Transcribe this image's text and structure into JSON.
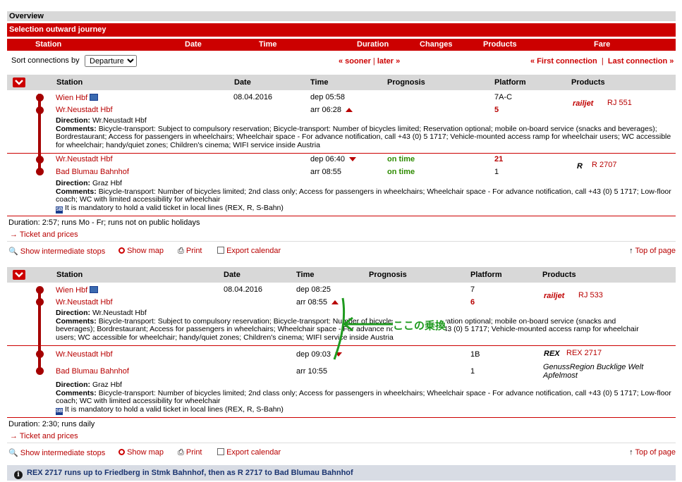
{
  "overview": "Overview",
  "selection": "Selection outward journey",
  "columns": {
    "station": "Station",
    "date": "Date",
    "time": "Time",
    "duration": "Duration",
    "changes": "Changes",
    "products": "Products",
    "fare": "Fare"
  },
  "sort": {
    "label": "Sort connections by",
    "value": "Departure",
    "sooner": "« sooner",
    "sep": "|",
    "later": "later »",
    "first": "« First connection",
    "last": "Last connection »"
  },
  "table_headers": {
    "station": "Station",
    "date": "Date",
    "time": "Time",
    "prognosis": "Prognosis",
    "platform": "Platform",
    "products": "Products"
  },
  "conn1": {
    "leg1": {
      "from": "Wien Hbf",
      "to": "Wr.Neustadt Hbf",
      "date": "08.04.2016",
      "dep": "dep 05:58",
      "arr": "arr 06:28",
      "plat_dep": "7A-C",
      "plat_arr": "5",
      "product_logo": "railjet",
      "product": "RJ 551",
      "direction_label": "Direction:",
      "direction": "Wr.Neustadt Hbf",
      "comments_label": "Comments:",
      "comments": "Bicycle-transport: Subject to compulsory reservation; Bicycle-transport: Number of bicycles limited; Reservation optional; mobile on-board service (snacks and beverages); Bordrestaurant; Access for passengers in wheelchairs; Wheelchair space - For advance notification, call +43 (0) 5 1717; Vehicle-mounted access ramp for wheelchair users; WC accessible for wheelchair; handy/quiet zones; Children's cinema; WIFI service inside Austria"
    },
    "leg2": {
      "from": "Wr.Neustadt Hbf",
      "to": "Bad Blumau Bahnhof",
      "dep": "dep 06:40",
      "arr": "arr 08:55",
      "prog_dep": "on time",
      "prog_arr": "on time",
      "plat_dep": "21",
      "plat_arr": "1",
      "product_logo": "R",
      "product": "R 2707",
      "direction_label": "Direction:",
      "direction": "Graz Hbf",
      "comments_label": "Comments:",
      "comments": "Bicycle-transport: Number of bicycles limited; 2nd class only; Access for passengers in wheelchairs; Wheelchair space - For advance notification, call +43 (0) 5 1717; Low-floor coach; WC with limited accessibility for wheelchair",
      "mandatory": "It is mandatory to hold a valid ticket in local lines (REX, R, S-Bahn)"
    },
    "duration": "Duration: 2:57; runs Mo - Fr; runs not on public holidays",
    "ticket": "Ticket and prices"
  },
  "actions": {
    "intermediate": "Show intermediate stops",
    "map": "Show map",
    "print": "Print",
    "export": "Export calendar",
    "top": "Top of page"
  },
  "conn2": {
    "leg1": {
      "from": "Wien Hbf",
      "to": "Wr.Neustadt Hbf",
      "date": "08.04.2016",
      "dep": "dep 08:25",
      "arr": "arr 08:55",
      "plat_dep": "7",
      "plat_arr": "6",
      "product_logo": "railjet",
      "product": "RJ 533",
      "direction_label": "Direction:",
      "direction": "Wr.Neustadt Hbf",
      "comments_label": "Comments:",
      "comments_a": "Bicycle-transport: Subject to compulsory reservation; Bicycle-transport: Number of bicycles limited; Reservation optional; mobile on-board service (snacks and",
      "comments_b": "beverages); Bordrestaurant; Access for passengers in wheelchairs; Wheelchair space - For advance notification, call +43 (0) 5 1717; Vehicle-mounted access ramp for wheelchair",
      "comments_c": "users; WC accessible for wheelchair; handy/quiet zones; Children's cinema; WIFI service inside Austria"
    },
    "leg2": {
      "from": "Wr.Neustadt Hbf",
      "to": "Bad Blumau Bahnhof",
      "dep": "dep 09:03",
      "arr": "arr 10:55",
      "plat_dep": "1B",
      "plat_arr": "1",
      "product_logo": "REX",
      "product": "REX 2717",
      "train_name": "GenussRegion Bucklige Welt Apfelmost",
      "direction_label": "Direction:",
      "direction": "Graz Hbf",
      "comments_label": "Comments:",
      "comments": "Bicycle-transport: Number of bicycles limited; 2nd class only; Access for passengers in wheelchairs; Wheelchair space - For advance notification, call +43 (0) 5 1717; Low-floor coach; WC with limited accessibility for wheelchair",
      "mandatory": "It is mandatory to hold a valid ticket in local lines (REX, R, S-Bahn)"
    },
    "duration": "Duration: 2:30; runs daily",
    "ticket": "Ticket and prices"
  },
  "annotation": "ここの乗換",
  "footer": "REX 2717 runs up to Friedberg in Stmk Bahnhof, then as R 2717 to Bad Blumau Bahnhof",
  "icons": {
    "sb": "SB",
    "info": "i"
  },
  "colors": {
    "accent": "#cc0000",
    "station_red": "#b80000",
    "on_time": "#2e8b00",
    "annotation_green": "#1f9a1f",
    "header_gray": "#d8d8d8",
    "footer_bg": "#d8dce4"
  }
}
